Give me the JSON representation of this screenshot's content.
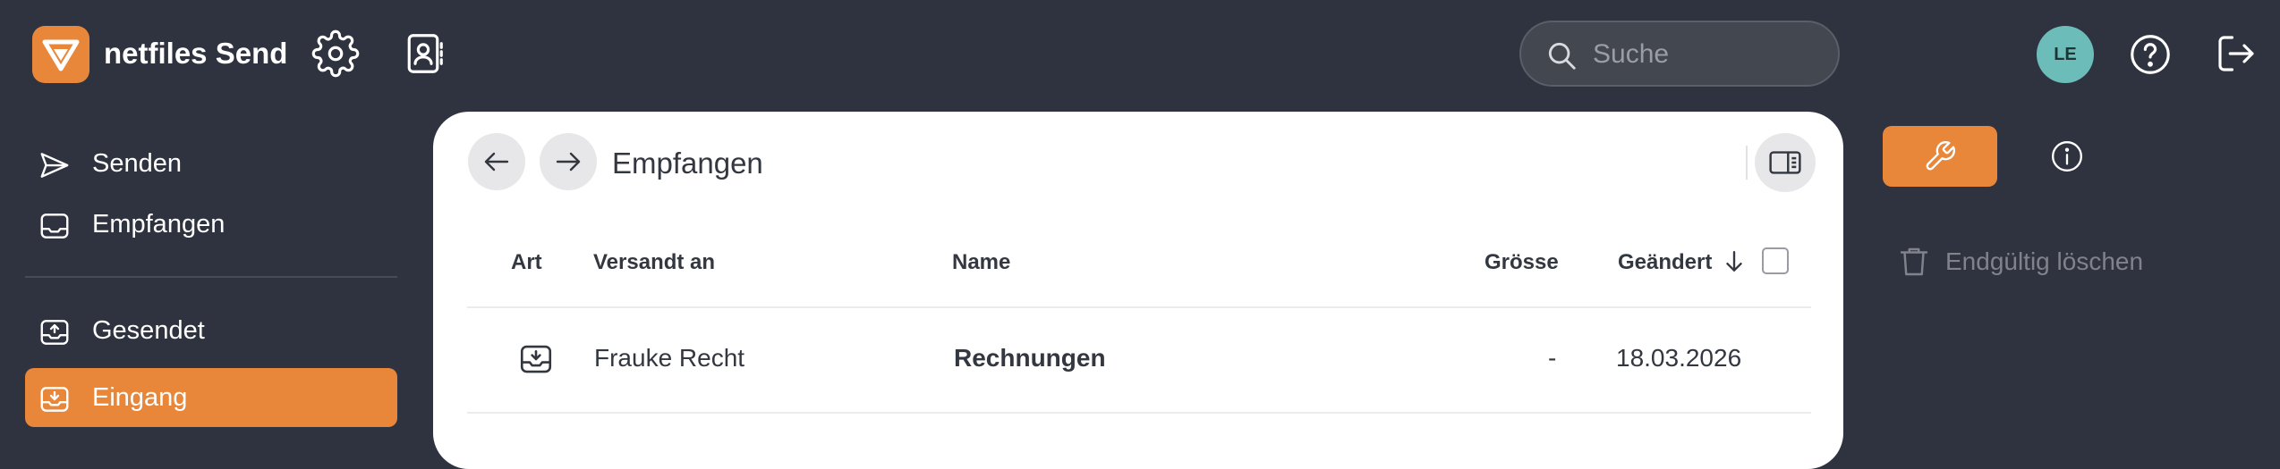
{
  "header": {
    "app_title": "netfiles Send",
    "search_placeholder": "Suche",
    "avatar_initials": "LE",
    "brand_color": "#e8873a",
    "icons": [
      "settings-gear-icon",
      "address-book-icon",
      "search-icon",
      "help-icon",
      "logout-icon"
    ]
  },
  "sidebar": {
    "items": [
      {
        "label": "Senden",
        "icon": "send-icon"
      },
      {
        "label": "Empfangen",
        "icon": "inbox-tray-icon"
      },
      {
        "label": "Gesendet",
        "icon": "upload-tray-icon"
      },
      {
        "label": "Eingang",
        "icon": "download-tray-icon",
        "active": true
      }
    ]
  },
  "main": {
    "breadcrumb": "Empfangen",
    "columns": {
      "art": "Art",
      "versandt_an": "Versandt an",
      "name": "Name",
      "groesse": "Grösse",
      "geaendert": "Geändert"
    },
    "sort": {
      "column": "geaendert",
      "direction": "descending"
    },
    "rows": [
      {
        "type_icon": "download-tray-icon",
        "versandt_an": "Frauke Recht",
        "name": "Rechnungen",
        "groesse": "-",
        "geaendert": "18.03.2026"
      }
    ]
  },
  "actions": {
    "delete_label": "Endgültig löschen",
    "tools_icon": "wrench-icon",
    "info_icon": "info-icon"
  }
}
